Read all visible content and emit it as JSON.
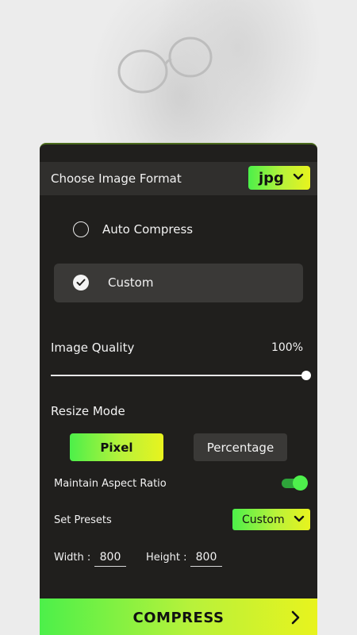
{
  "format": {
    "label": "Choose Image Format",
    "selected": "jpg"
  },
  "compression": {
    "auto_label": "Auto Compress",
    "custom_label": "Custom",
    "selected": "Custom"
  },
  "quality": {
    "label": "Image Quality",
    "value_text": "100%",
    "value": 1.0
  },
  "resize": {
    "label": "Resize Mode",
    "pixel_label": "Pixel",
    "percentage_label": "Percentage",
    "selected": "Pixel"
  },
  "aspect": {
    "label": "Maintain Aspect Ratio",
    "enabled": true
  },
  "presets": {
    "label": "Set Presets",
    "selected": "Custom"
  },
  "dimensions": {
    "width_label": "Width :",
    "width_value": "800",
    "height_label": "Height :",
    "height_value": "800"
  },
  "action": {
    "compress_label": "COMPRESS"
  },
  "colors": {
    "accent_start": "#4cf04a",
    "accent_end": "#e8f31e",
    "panel_bg": "#201f1d",
    "toggle_on": "#4ef04c"
  },
  "icons": {
    "format_dropdown": "chevron-down-icon",
    "presets_dropdown": "chevron-down-icon",
    "compress_arrow": "chevron-right-icon",
    "custom_check": "check-icon"
  }
}
